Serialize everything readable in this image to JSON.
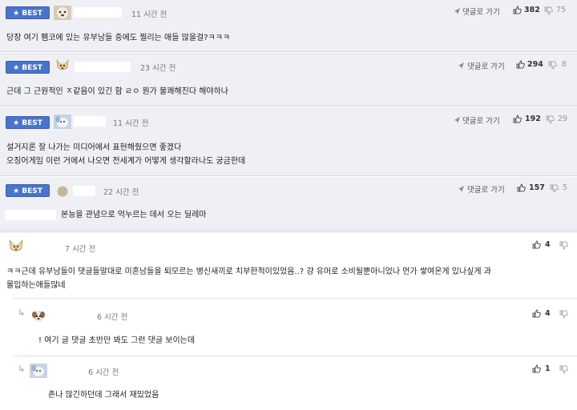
{
  "best_label": "★ BEST",
  "reply_link_label": "댓글로 가기",
  "comments": [
    {
      "time": "11 시간 전",
      "likes": "382",
      "dislikes": "75",
      "text": "당장 여기 펨코에 있는 유부남들 중에도 찔리는 애들 많을걸?ㅋㅋㅋ"
    },
    {
      "time": "23 시간 전",
      "likes": "294",
      "dislikes": "8",
      "text": "근데 그 근원적인 ㅈ같음이 있긴 함 ㄹㅇ 뭔가 불쾌해진다 해야하나"
    },
    {
      "time": "11 시간 전",
      "likes": "192",
      "dislikes": "29",
      "text_line1": "설거지론 잘 나가는 미디어에서 표현해줬으면 좋겠다",
      "text_line2": "오징어게임 이런 거에서 나오면 전세계가 어떻게 생각할라나도 궁금한데"
    },
    {
      "time": "22 시간 전",
      "likes": "157",
      "dislikes": "5",
      "text": "본능을 관념으로 억누르는 데서 오는 딜레마"
    }
  ],
  "thread": {
    "main": {
      "time": "7 시간 전",
      "likes": "4",
      "text_line1": "ㅋㅋ근데 유부남들이 댓글들말대로 미혼남들을 퇴모르는 병신새끼로 치부한적이있었음..? 걍 유머로 소비될뿐아니었나 먼가 쌓여온게 있나싶게 과",
      "text_line2": "몰입하는애들많네"
    },
    "reply1": {
      "time": "6 시간 전",
      "likes": "4",
      "text": "! 여기 글 댓글 초반만 봐도 그런 댓글 보이는데"
    },
    "reply2": {
      "time": "6 시간 전",
      "likes": "1",
      "text": "존나 많긴하던데 그래서 재밌었음"
    }
  },
  "colors": {
    "best_badge": "#4a74c9",
    "best_row_bg": "#eef0f6"
  }
}
